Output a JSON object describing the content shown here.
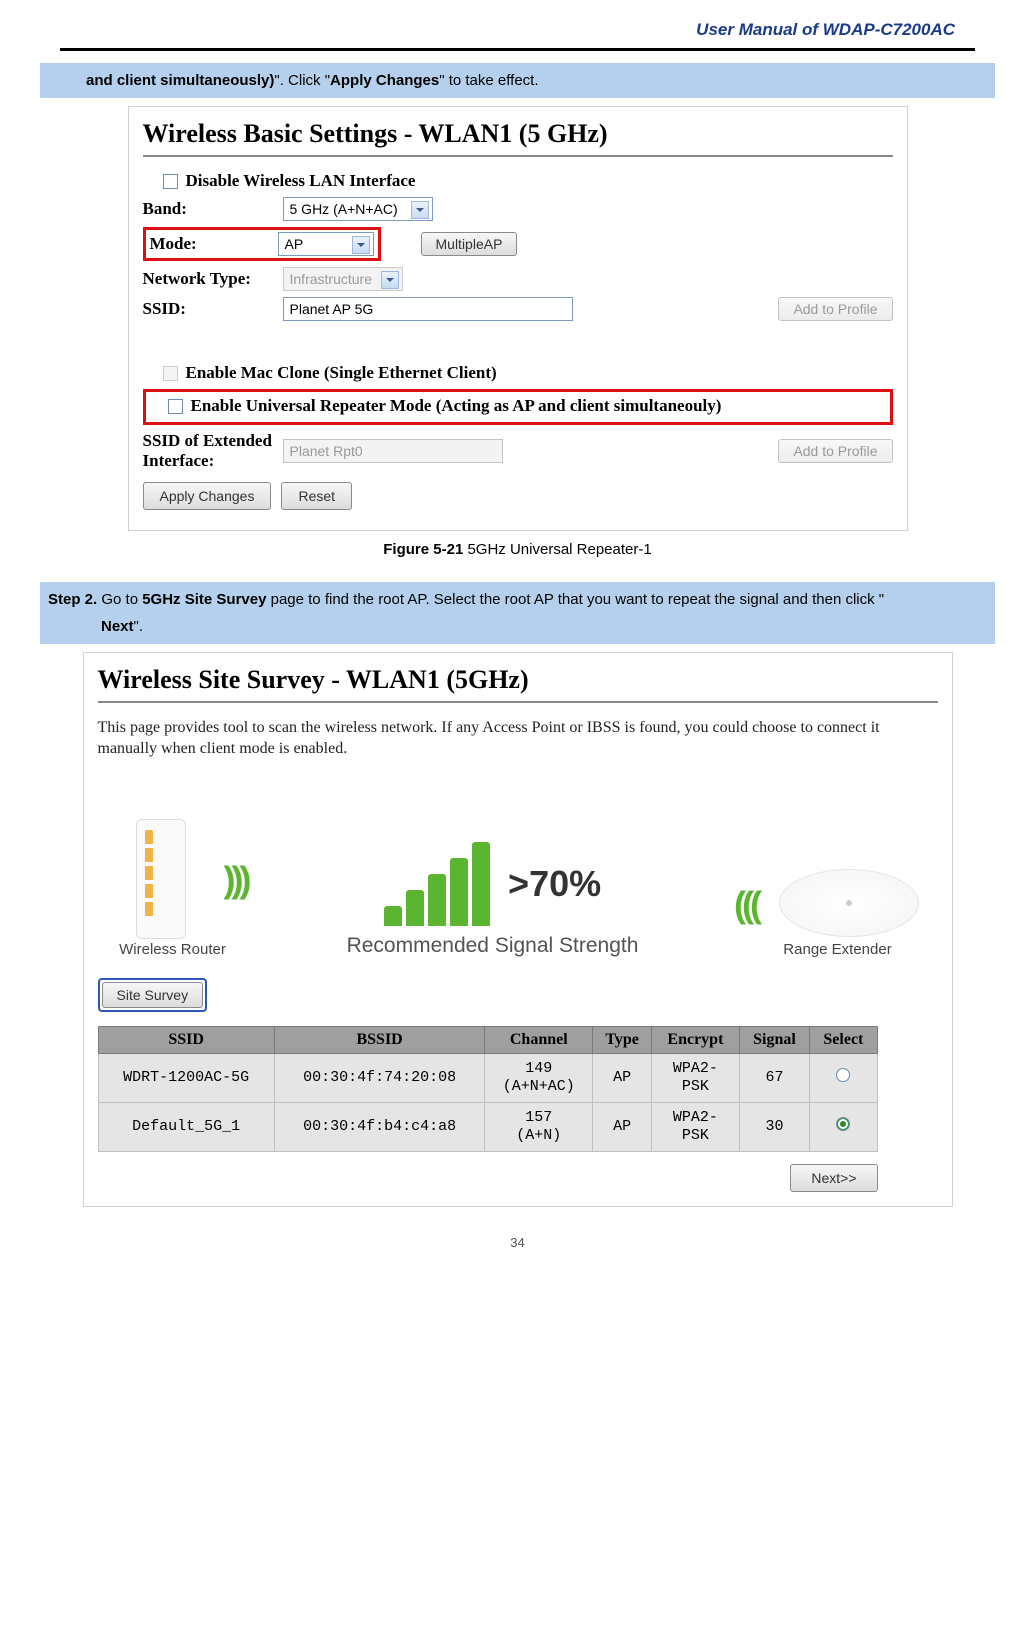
{
  "doc_header": "User Manual of WDAP-C7200AC",
  "step1_bar": {
    "bold_fragment": "and client simultaneously)",
    "mid1": "\". Click \"",
    "bold_apply": "Apply Changes",
    "tail": "\" to take effect."
  },
  "fig1": {
    "title": "Wireless Basic Settings - WLAN1 (5 GHz)",
    "disable_label": "Disable Wireless LAN Interface",
    "band_label": "Band:",
    "band_value": "5 GHz (A+N+AC)",
    "mode_label": "Mode:",
    "mode_value": "AP",
    "multiple_ap_btn": "MultipleAP",
    "nettype_label": "Network Type:",
    "nettype_value": "Infrastructure",
    "ssid_label": "SSID:",
    "ssid_value": "Planet AP 5G",
    "add_profile_btn": "Add to Profile",
    "mac_clone_label": "Enable Mac Clone (Single Ethernet Client)",
    "repeater_label": "Enable Universal Repeater Mode (Acting as AP and client simultaneouly)",
    "ssid_ext_label_l1": "SSID of Extended",
    "ssid_ext_label_l2": "Interface:",
    "ssid_ext_value": "Planet Rpt0",
    "apply_btn": "Apply Changes",
    "reset_btn": "Reset",
    "caption_bold": "Figure 5-21",
    "caption_rest": " 5GHz Universal Repeater-1"
  },
  "step2_bar": {
    "step": "Step 2.",
    "pre": "Go to ",
    "bold1": "5GHz Site Survey",
    "mid": " page to find the root AP. Select the root AP that you want to repeat the signal and then click \"",
    "bold2": "Next",
    "tail": "\"."
  },
  "fig2": {
    "title": "Wireless Site Survey - WLAN1 (5GHz)",
    "desc": "This page provides tool to scan the wireless network. If any Access Point or IBSS is found, you could choose to connect it manually when client mode is enabled.",
    "router_label": "Wireless Router",
    "pct": ">70%",
    "rec_text": "Recommended Signal Strength",
    "extender_label": "Range Extender",
    "site_survey_btn": "Site Survey",
    "headers": [
      "SSID",
      "BSSID",
      "Channel",
      "Type",
      "Encrypt",
      "Signal",
      "Select"
    ],
    "rows": [
      {
        "ssid": "WDRT-1200AC-5G",
        "bssid": "00:30:4f:74:20:08",
        "channel": "149 (A+N+AC)",
        "type": "AP",
        "encrypt": "WPA2-PSK",
        "signal": "67",
        "selected": false
      },
      {
        "ssid": "Default_5G_1",
        "bssid": "00:30:4f:b4:c4:a8",
        "channel": "157 (A+N)",
        "type": "AP",
        "encrypt": "WPA2-PSK",
        "signal": "30",
        "selected": true
      }
    ],
    "next_btn": "Next>>"
  },
  "page_number": "34"
}
